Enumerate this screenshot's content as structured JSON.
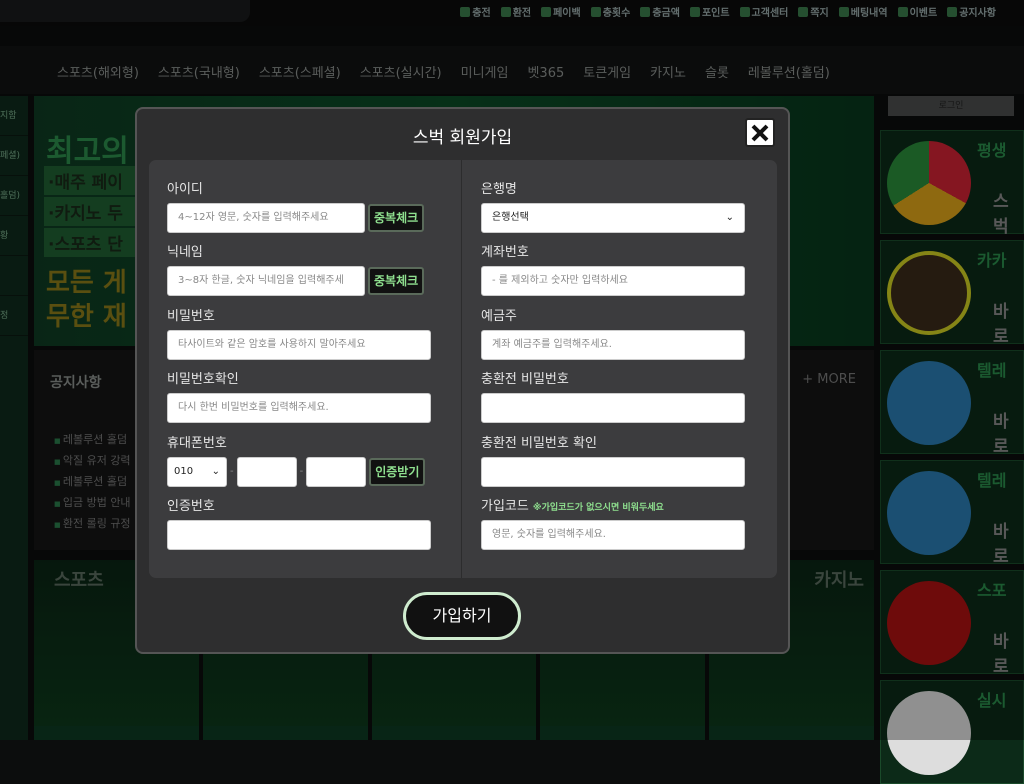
{
  "topbar": {
    "links": [
      "충전",
      "환전",
      "페이백",
      "충횟수",
      "충금액",
      "포인트",
      "고객센터",
      "쪽지",
      "베팅내역",
      "이벤트",
      "공지사항"
    ]
  },
  "nav": {
    "items": [
      "스포츠(해외형)",
      "스포츠(국내형)",
      "스포츠(스페셜)",
      "스포츠(실시간)",
      "미니게임",
      "벳365",
      "토큰게임",
      "카지노",
      "슬롯",
      "레볼루션(홀덤)"
    ]
  },
  "left_menu": [
    "지함",
    "페셜)",
    "홀덤)",
    "황",
    "",
    "정"
  ],
  "banner": {
    "headline": "최고의",
    "lines": [
      "·매주 페이",
      "·카지노 두",
      "·스포츠 단"
    ],
    "yellow": [
      "모든 게",
      "무한 재"
    ]
  },
  "notice": {
    "title": "공지사항",
    "more": "+ MORE",
    "items": [
      "레볼루션 홀덤",
      "악질 유저 강력",
      "레볼루션 홀덤",
      "입금 방법 안내",
      "환전 롤링 규정"
    ]
  },
  "games": [
    {
      "title": "스포츠"
    },
    {
      "title": ""
    },
    {
      "title": ""
    },
    {
      "title": ""
    },
    {
      "title": "카지노"
    }
  ],
  "right": {
    "login": "로그인",
    "cards": [
      {
        "title": "평생",
        "cta": "스벅",
        "color": "#c23"
      },
      {
        "title": "카카",
        "cta": "바로",
        "color": "#cc2"
      },
      {
        "title": "텔레",
        "cta": "바로",
        "color": "#2a8acb"
      },
      {
        "title": "텔레",
        "cta": "바로",
        "color": "#2a8acb"
      },
      {
        "title": "스포",
        "cta": "바로",
        "color": "#b11"
      },
      {
        "title": "실시",
        "cta": "",
        "color": "#eee"
      }
    ]
  },
  "modal": {
    "title": "스벅 회원가입",
    "close_icon": "close-x-icon",
    "left": {
      "id": {
        "label": "아이디",
        "placeholder": "4~12자 영문, 숫자를 입력해주세요",
        "button": "중복체크"
      },
      "nickname": {
        "label": "닉네임",
        "placeholder": "3~8자 한글, 숫자 닉네임을 입력해주세",
        "button": "중복체크"
      },
      "password": {
        "label": "비밀번호",
        "placeholder": "타사이트와 같은 암호를 사용하지 말아주세요"
      },
      "password_confirm": {
        "label": "비밀번호확인",
        "placeholder": "다시 한번 비밀번호를 입력해주세요."
      },
      "phone": {
        "label": "휴대폰번호",
        "prefix": "010",
        "sep": "-",
        "button": "인증받기"
      },
      "auth_code": {
        "label": "인증번호",
        "placeholder": ""
      }
    },
    "right": {
      "bank": {
        "label": "은행명",
        "value": "은행선택"
      },
      "account": {
        "label": "계좌번호",
        "placeholder": "- 를 제외하고 숫자만 입력하세요"
      },
      "holder": {
        "label": "예금주",
        "placeholder": "계좌 예금주를 입력해주세요."
      },
      "tx_password": {
        "label": "충환전 비밀번호",
        "placeholder": ""
      },
      "tx_password_confirm": {
        "label": "충환전 비밀번호 확인",
        "placeholder": ""
      },
      "join_code": {
        "label": "가입코드",
        "note": "※가입코드가 없으시면 비워두세요",
        "placeholder": "영문, 숫자를 입력해주세요."
      }
    },
    "submit": "가입하기"
  },
  "colors": {
    "accent": "#8fe08f",
    "modal_bg": "#2e2e2f",
    "panel_bg": "#3c3c3e",
    "brand_green": "#0e3a22"
  }
}
